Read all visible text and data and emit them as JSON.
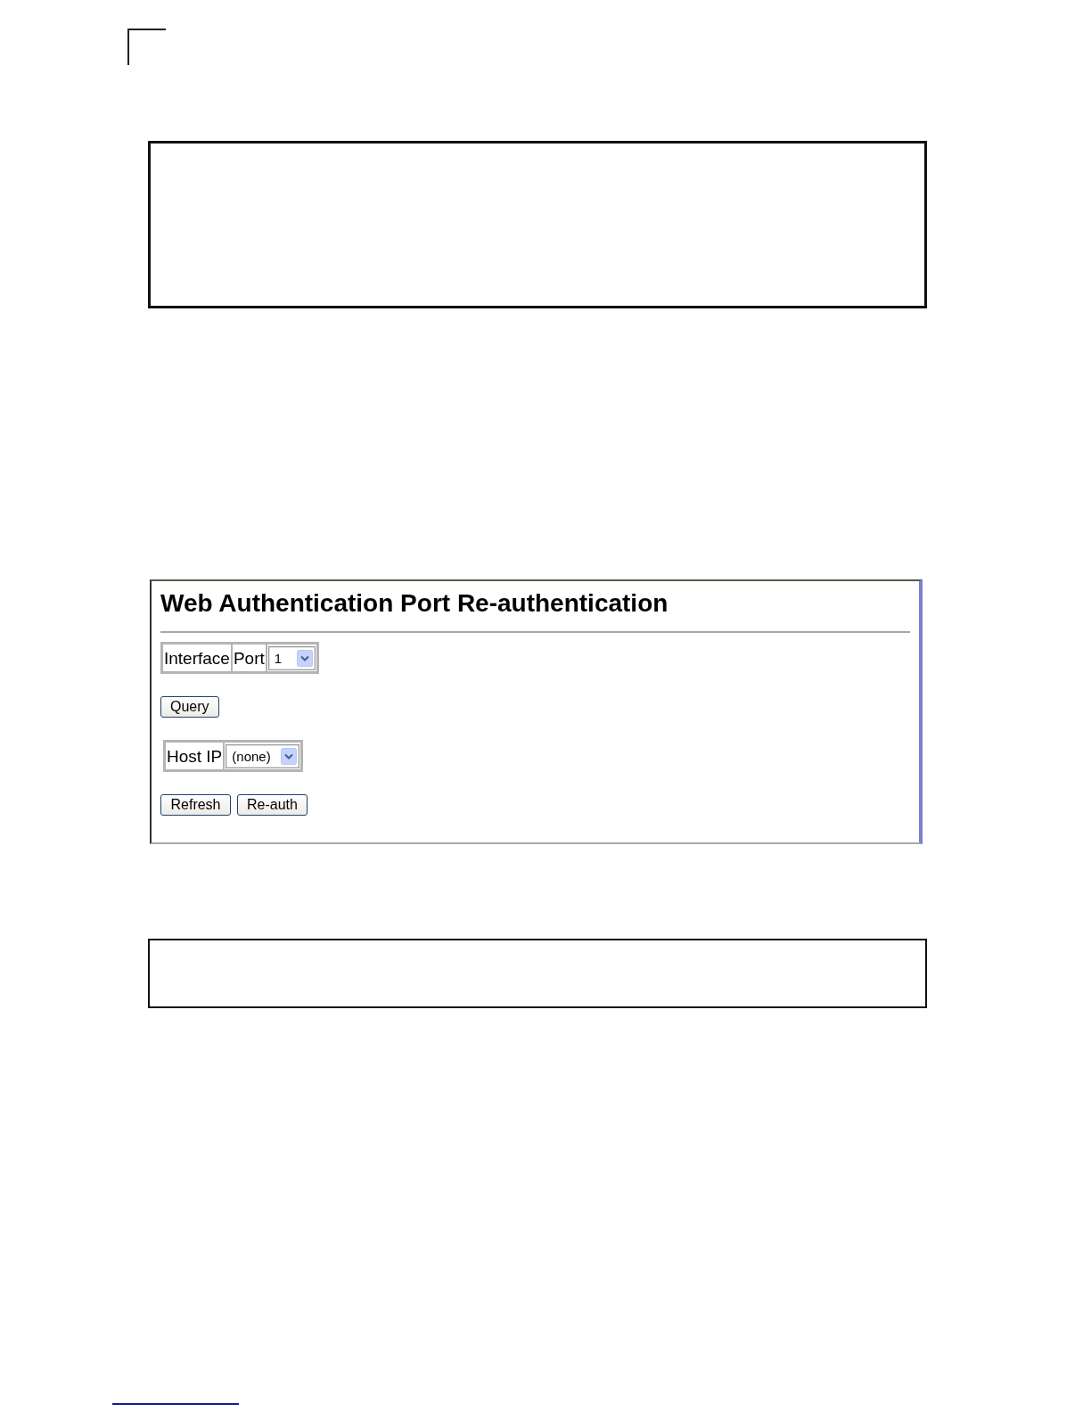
{
  "panel": {
    "title": "Web Authentication Port Re-authentication",
    "interface": {
      "label": "Interface",
      "port_label": "Port",
      "port_value": "1"
    },
    "query_button": "Query",
    "host_ip": {
      "label": "Host IP",
      "value": "(none)"
    },
    "buttons": [
      "Refresh",
      "Re-auth"
    ]
  }
}
